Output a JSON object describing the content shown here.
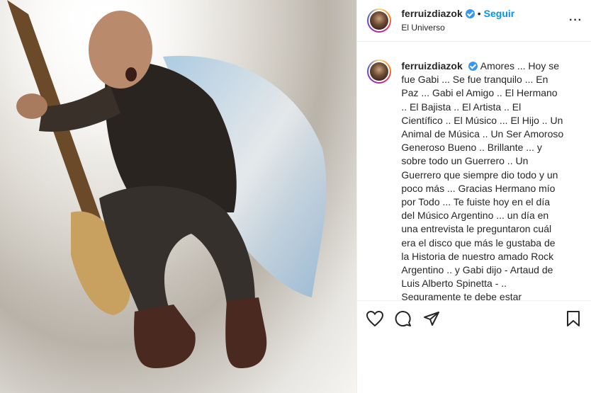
{
  "post": {
    "username": "ferruizdiazok",
    "follow_label": "Seguir",
    "separator": "•",
    "location": "El Universo",
    "caption": "Amores ... Hoy se fue Gabi ... Se fue tranquilo ... En Paz ... Gabi el Amigo .. El Hermano .. El Bajista .. El Artista .. El Científico .. El Músico ... El Hijo .. Un Animal de Música .. Un Ser Amoroso Generoso Bueno .. Brillante ... y sobre todo un Guerrero .. Un Guerrero que siempre dio todo y un poco más ... Gracias Hermano mío por Todo ... Te fuiste hoy en el día del Músico Argentino ... un día en una entrevista le preguntaron cuál era el disco que más le gustaba de la Historia de nuestro amado Rock Argentino .. y Gabi dijo - Artaud de Luis Alberto Spinetta - .. Seguramente te debe estar esperando para que con tus Cuatro Cuerdas Mágicas hagas lo que más amaste en tu Maravillosa e"
  },
  "icons": {
    "like": "heart-icon",
    "comment": "comment-icon",
    "share": "share-icon",
    "save": "bookmark-icon",
    "more": "more-options-icon",
    "verified": "verified-badge-icon"
  },
  "colors": {
    "link": "#0095f6",
    "verified": "#3897f0",
    "text": "#262626"
  }
}
